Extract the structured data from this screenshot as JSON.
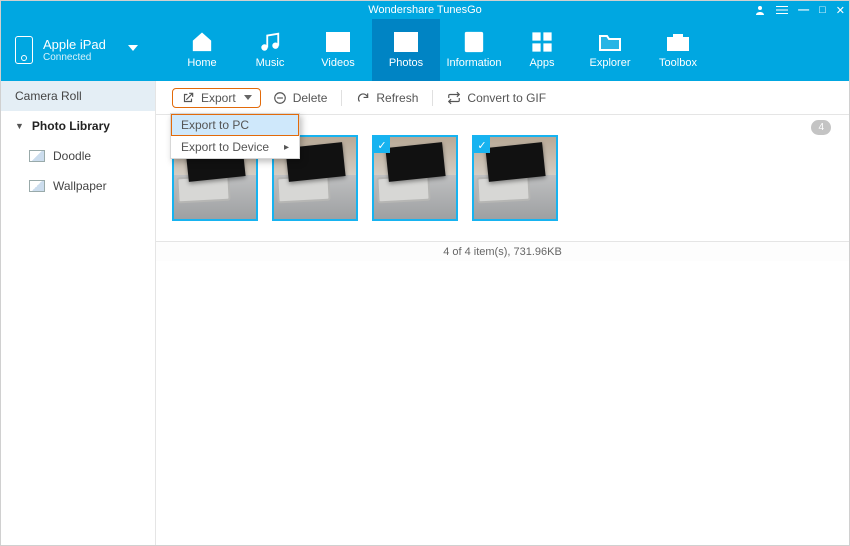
{
  "app": {
    "title": "Wondershare TunesGo"
  },
  "device": {
    "name": "Apple iPad",
    "status": "Connected"
  },
  "nav": {
    "items": [
      {
        "key": "home",
        "label": "Home"
      },
      {
        "key": "music",
        "label": "Music"
      },
      {
        "key": "videos",
        "label": "Videos"
      },
      {
        "key": "photos",
        "label": "Photos",
        "active": true
      },
      {
        "key": "information",
        "label": "Information"
      },
      {
        "key": "apps",
        "label": "Apps"
      },
      {
        "key": "explorer",
        "label": "Explorer"
      },
      {
        "key": "toolbox",
        "label": "Toolbox"
      }
    ]
  },
  "sidebar": {
    "items": [
      {
        "key": "camera-roll",
        "label": "Camera Roll",
        "selected": true,
        "type": "cat"
      },
      {
        "key": "photo-library",
        "label": "Photo Library",
        "type": "cat-expand"
      },
      {
        "key": "doodle",
        "label": "Doodle",
        "type": "sub"
      },
      {
        "key": "wallpaper",
        "label": "Wallpaper",
        "type": "sub"
      }
    ]
  },
  "toolbar": {
    "export": "Export",
    "delete": "Delete",
    "refresh": "Refresh",
    "convert": "Convert to GIF",
    "count_badge": "4"
  },
  "export_menu": {
    "pc": "Export to PC",
    "device": "Export to Device"
  },
  "thumbs": {
    "count": 4
  },
  "status": {
    "text": "4 of 4 item(s), 731.96KB"
  }
}
